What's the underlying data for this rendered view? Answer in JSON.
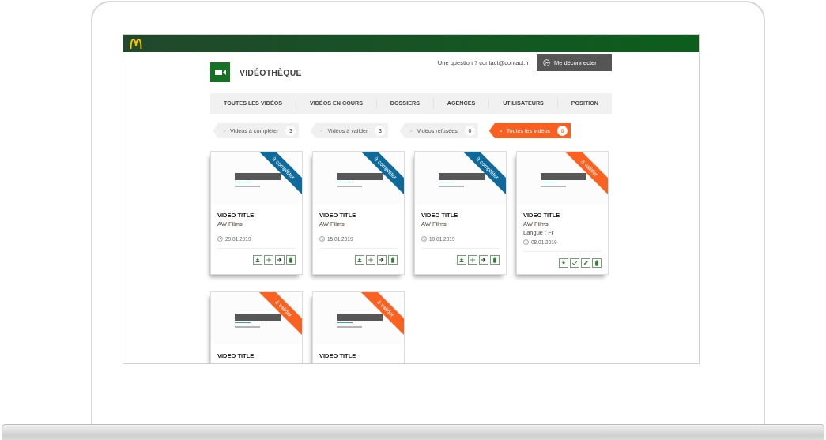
{
  "header": {
    "title": "VIDÉOTHÈQUE",
    "question": "Une question ? contact@contact.fr",
    "logout": "Me déconnecter"
  },
  "nav": [
    {
      "label": "TOUTES LES VIDÉOS"
    },
    {
      "label": "VIDÉOS EN COURS"
    },
    {
      "label": "DOSSIERS"
    },
    {
      "label": "AGENCES"
    },
    {
      "label": "UTILISATEURS"
    },
    {
      "label": "POSITION"
    }
  ],
  "filters": [
    {
      "label": "Vidéos à compléter",
      "count": "3",
      "selected": false
    },
    {
      "label": "Vidéos à valider",
      "count": "3",
      "selected": false
    },
    {
      "label": "Vidéos refusées",
      "count": "0",
      "selected": false
    },
    {
      "label": "Toutes les vidéos",
      "count": "6",
      "selected": true
    }
  ],
  "videos": [
    {
      "ribbon": {
        "label": "à compléter",
        "color": "#0f6a9c"
      },
      "title": "VIDEO TITLE",
      "studio": "AW Films",
      "date": "29.01.2019",
      "actions": [
        {
          "kind": "download"
        },
        {
          "kind": "add"
        },
        {
          "kind": "forward"
        },
        {
          "kind": "delete"
        }
      ]
    },
    {
      "ribbon": {
        "label": "à compléter",
        "color": "#0f6a9c"
      },
      "title": "VIDEO TITLE",
      "studio": "AW Films",
      "date": "15.01.2019",
      "actions": [
        {
          "kind": "download"
        },
        {
          "kind": "add"
        },
        {
          "kind": "forward"
        },
        {
          "kind": "delete"
        }
      ]
    },
    {
      "ribbon": {
        "label": "à compléter",
        "color": "#0f6a9c"
      },
      "title": "VIDEO TITLE",
      "studio": "AW Films",
      "date": "10.01.2019",
      "actions": [
        {
          "kind": "download"
        },
        {
          "kind": "add"
        },
        {
          "kind": "forward"
        },
        {
          "kind": "delete"
        }
      ]
    },
    {
      "ribbon": {
        "label": "à valider",
        "color": "#fb6222"
      },
      "title": "VIDEO TITLE",
      "studio": "AW Films",
      "language": "Langue : Fr",
      "date": "08.01.2019",
      "actions": [
        {
          "kind": "download"
        },
        {
          "kind": "check"
        },
        {
          "kind": "edit"
        },
        {
          "kind": "delete"
        }
      ]
    },
    {
      "ribbon": {
        "label": "à valider",
        "color": "#fb6222"
      },
      "title": "VIDEO TITLE"
    },
    {
      "ribbon": {
        "label": "à valider",
        "color": "#fb6222"
      },
      "title": "VIDEO TITLE"
    }
  ]
}
